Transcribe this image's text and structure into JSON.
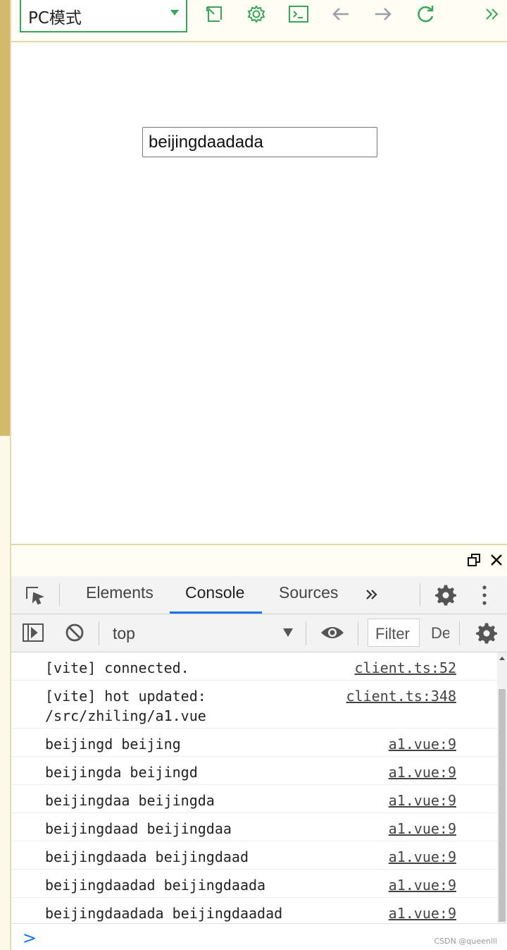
{
  "toolbar": {
    "mode_label": "PC模式",
    "icons": [
      "external-window-icon",
      "gear-icon",
      "terminal-icon",
      "arrow-left-icon",
      "arrow-right-icon",
      "refresh-icon",
      "double-chevron-right-icon"
    ],
    "accent_color": "#3aa55a"
  },
  "preview": {
    "input_value": "beijingdaadada"
  },
  "devtools": {
    "tabs": [
      "Elements",
      "Console",
      "Sources"
    ],
    "active_tab": "Console",
    "context": "top",
    "filter_placeholder": "Filter",
    "levels_label": "De",
    "accent_color": "#1a73e8",
    "logs": [
      {
        "message": "[vite] connected.",
        "source": "client.ts:52"
      },
      {
        "message": "[vite] hot updated:\n/src/zhiling/a1.vue",
        "source": "client.ts:348"
      },
      {
        "message": "beijingd beijing",
        "source": "a1.vue:9"
      },
      {
        "message": "beijingda beijingd",
        "source": "a1.vue:9"
      },
      {
        "message": "beijingdaa beijingda",
        "source": "a1.vue:9"
      },
      {
        "message": "beijingdaad beijingdaa",
        "source": "a1.vue:9"
      },
      {
        "message": "beijingdaada beijingdaad",
        "source": "a1.vue:9"
      },
      {
        "message": "beijingdaadad beijingdaada",
        "source": "a1.vue:9"
      },
      {
        "message": "beijingdaadada beijingdaadad",
        "source": "a1.vue:9"
      }
    ],
    "prompt_symbol": ">"
  },
  "watermark": "CSDN @queenlll"
}
